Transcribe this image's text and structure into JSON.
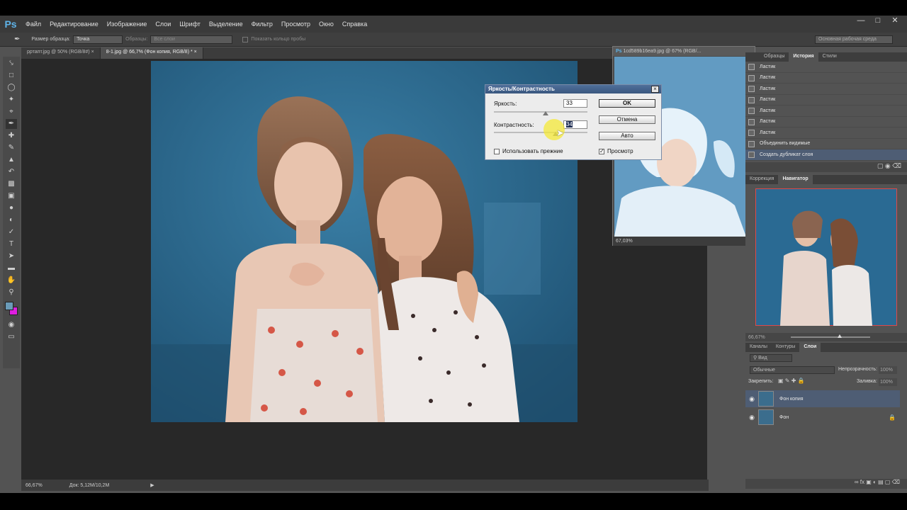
{
  "app": {
    "logo": "Ps"
  },
  "menu": [
    "Файл",
    "Редактирование",
    "Изображение",
    "Слои",
    "Шрифт",
    "Выделение",
    "Фильтр",
    "Просмотр",
    "Окно",
    "Справка"
  ],
  "options": {
    "sample_size_label": "Размер образца:",
    "sample_size_value": "Точка",
    "samples_label": "Образцы:",
    "samples_value": "Все слои",
    "show_ring_label": "Показать кольцо пробы",
    "workspace": "Основная рабочая среда"
  },
  "tabs": [
    {
      "label": "рртапт.jpg @ 50% (RGB/8#)"
    },
    {
      "label": "8-1.jpg @ 66,7% (Фон копия, RGB/8) *"
    }
  ],
  "float_doc": {
    "title": "1cd589b16ea9.jpg @ 67% (RGB/...",
    "zoom": "67,03%"
  },
  "status": {
    "zoom": "66,67%",
    "doc": "Док: 5,12М/10,2М"
  },
  "dialog": {
    "title": "Яркость/Контрастность",
    "brightness_label": "Яркость:",
    "brightness_value": "33",
    "contrast_label": "Контрастность:",
    "contrast_value": "34",
    "ok": "OK",
    "cancel": "Отмена",
    "auto": "Авто",
    "use_legacy": "Использовать прежние",
    "preview": "Просмотр",
    "brightness_fraction": 0.55,
    "contrast_fraction": 0.66
  },
  "history": {
    "tabs": [
      "Образцы",
      "История",
      "Стили"
    ],
    "items": [
      "Ластик",
      "Ластик",
      "Ластик",
      "Ластик",
      "Ластик",
      "Ластик",
      "Ластик",
      "Объединить видимые",
      "Создать дубликат слоя"
    ]
  },
  "navigator": {
    "tabs": [
      "Коррекция",
      "Навигатор"
    ],
    "zoom": "66,67%"
  },
  "layers": {
    "tabs": [
      "Каналы",
      "Контуры",
      "Слои"
    ],
    "kind": "Вид",
    "blend": "Обычные",
    "opacity_label": "Непрозрачность:",
    "opacity": "100%",
    "lock_label": "Закрепить:",
    "fill_label": "Заливка:",
    "fill": "100%",
    "items": [
      "Фон копия",
      "Фон"
    ]
  }
}
